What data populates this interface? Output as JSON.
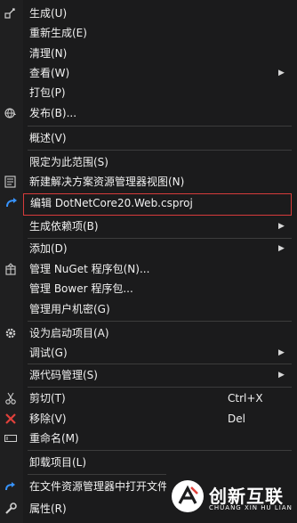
{
  "menu": {
    "items": [
      {
        "label": "生成(U)",
        "icon": "build-icon"
      },
      {
        "label": "重新生成(E)"
      },
      {
        "label": "清理(N)"
      },
      {
        "label": "查看(W)",
        "submenu": true
      },
      {
        "label": "打包(P)"
      },
      {
        "label": "发布(B)...",
        "icon": "publish-globe-icon"
      },
      {
        "label": "概述(V)"
      },
      {
        "label": "限定为此范围(S)"
      },
      {
        "label": "新建解决方案资源管理器视图(N)",
        "icon": "new-view-icon"
      },
      {
        "label": "编辑 DotNetCore20.Web.csproj",
        "icon": "edit-arrow-icon",
        "highlighted": true
      },
      {
        "label": "生成依赖项(B)",
        "submenu": true
      },
      {
        "label": "添加(D)",
        "submenu": true
      },
      {
        "label": "管理 NuGet 程序包(N)...",
        "icon": "nuget-package-icon"
      },
      {
        "label": "管理 Bower 程序包..."
      },
      {
        "label": "管理用户机密(G)"
      },
      {
        "label": "设为启动项目(A)",
        "icon": "gear-icon"
      },
      {
        "label": "调试(G)",
        "submenu": true
      },
      {
        "label": "源代码管理(S)",
        "submenu": true
      },
      {
        "label": "剪切(T)",
        "shortcut": "Ctrl+X",
        "icon": "scissors-icon"
      },
      {
        "label": "移除(V)",
        "shortcut": "Del",
        "icon": "remove-x-icon"
      },
      {
        "label": "重命名(M)",
        "icon": "rename-icon"
      },
      {
        "label": "卸载项目(L)"
      },
      {
        "label": "在文件资源管理器中打开文件",
        "icon": "open-folder-arrow-icon"
      },
      {
        "label": "属性(R)",
        "icon": "wrench-icon"
      }
    ],
    "submenu_arrow": "▶"
  },
  "logo": {
    "name": "创新互联",
    "pinyin": "CHUANG XIN HU LIAN"
  },
  "colors": {
    "background": "#1b1b1c",
    "text": "#f1f1f1",
    "separator": "#3c3c3c",
    "highlight_border": "#d63b3b",
    "accent_blue": "#3794ff",
    "remove_red": "#e0413b"
  }
}
